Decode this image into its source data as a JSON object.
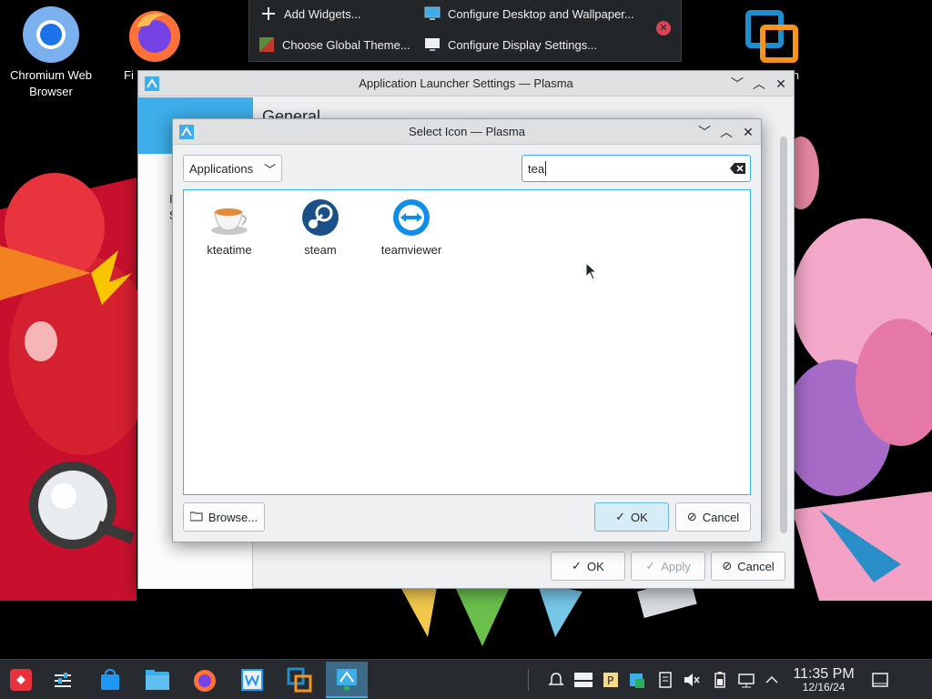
{
  "desktop": {
    "icons": [
      {
        "label": "Chromium Web\nBrowser",
        "icon": "chromium-icon"
      },
      {
        "label": "Fi",
        "icon": "firefox-icon"
      },
      {
        "label": "on",
        "icon": "virtualbox-icon"
      }
    ]
  },
  "desktop_menu": {
    "items": [
      {
        "label": "Add Widgets...",
        "icon": "plus-icon"
      },
      {
        "label": "Configure Desktop and Wallpaper...",
        "icon": "desktop-icon"
      },
      {
        "label": "Choose Global Theme...",
        "icon": "theme-icon"
      },
      {
        "label": "Configure Display Settings...",
        "icon": "display-icon"
      }
    ]
  },
  "settings_window": {
    "title": "Application Launcher Settings — Plasma",
    "heading": "General",
    "side_fragment_1": "I",
    "side_fragment_2": "S",
    "ok_label": "OK",
    "apply_label": "Apply",
    "cancel_label": "Cancel"
  },
  "icon_dialog": {
    "title": "Select Icon — Plasma",
    "category": "Applications",
    "search_value": "tea",
    "results": [
      {
        "label": "kteatime",
        "icon": "teacup-icon"
      },
      {
        "label": "steam",
        "icon": "steam-icon"
      },
      {
        "label": "teamviewer",
        "icon": "teamviewer-icon"
      }
    ],
    "browse_label": "Browse...",
    "ok_label": "OK",
    "cancel_label": "Cancel"
  },
  "taskbar": {
    "clock_time": "11:35 PM",
    "clock_date": "12/16/24"
  },
  "colors": {
    "accent": "#3daee9",
    "panel": "#272b30",
    "window_bg": "#eff0f1"
  }
}
